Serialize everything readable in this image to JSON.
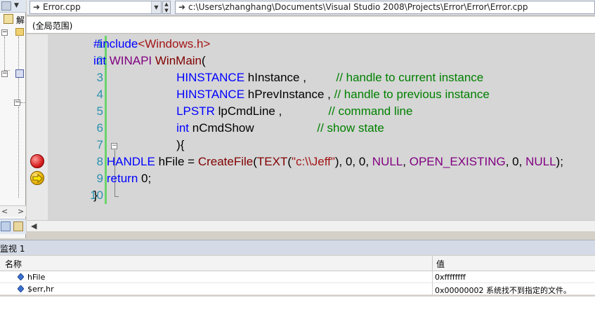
{
  "nav": {
    "file_combo": "Error.cpp",
    "path_combo": "c:\\Users\\zhanghang\\Documents\\Visual Studio 2008\\Projects\\Error\\Error\\Error.cpp",
    "scope": "(全局范围)"
  },
  "left_panel": {
    "partial_label": "解",
    "scroll_left": "<",
    "scroll_right": ">"
  },
  "code": {
    "line_numbers": [
      "1",
      "2",
      "3",
      "4",
      "5",
      "6",
      "7",
      "8",
      "9",
      "10"
    ],
    "lines": [
      {
        "segments": [
          {
            "t": "#include",
            "c": "kw"
          },
          {
            "t": "<Windows.h>",
            "c": "str"
          }
        ]
      },
      {
        "segments": [
          {
            "t": "int",
            "c": "kw"
          },
          {
            "t": " ",
            "c": ""
          },
          {
            "t": "WINAPI",
            "c": "mac"
          },
          {
            "t": " ",
            "c": ""
          },
          {
            "t": "WinMain",
            "c": "fn"
          },
          {
            "t": "(",
            "c": ""
          }
        ]
      },
      {
        "segments": [
          {
            "t": "                         HINSTANCE",
            "c": "kw"
          },
          {
            "t": " hInstance ,         ",
            "c": ""
          },
          {
            "t": "// handle to current instance",
            "c": "cm"
          }
        ]
      },
      {
        "segments": [
          {
            "t": "                         HINSTANCE",
            "c": "kw"
          },
          {
            "t": " hPrevInstance , ",
            "c": ""
          },
          {
            "t": "// handle to previous instance",
            "c": "cm"
          }
        ]
      },
      {
        "segments": [
          {
            "t": "                         LPSTR",
            "c": "kw"
          },
          {
            "t": " lpCmdLine ,              ",
            "c": ""
          },
          {
            "t": "// command line",
            "c": "cm"
          }
        ]
      },
      {
        "segments": [
          {
            "t": "                         int",
            "c": "kw"
          },
          {
            "t": " nCmdShow                   ",
            "c": ""
          },
          {
            "t": "// show state",
            "c": "cm"
          }
        ]
      },
      {
        "segments": [
          {
            "t": "                         ){",
            "c": ""
          }
        ]
      },
      {
        "segments": [
          {
            "t": "    HANDLE",
            "c": "kw"
          },
          {
            "t": " hFile = ",
            "c": ""
          },
          {
            "t": "CreateFile",
            "c": "fn"
          },
          {
            "t": "(",
            "c": ""
          },
          {
            "t": "TEXT",
            "c": "fn"
          },
          {
            "t": "(",
            "c": ""
          },
          {
            "t": "\"c:\\\\Jeff\"",
            "c": "str"
          },
          {
            "t": "), 0, 0, ",
            "c": ""
          },
          {
            "t": "NULL",
            "c": "mac"
          },
          {
            "t": ", ",
            "c": ""
          },
          {
            "t": "OPEN_EXISTING",
            "c": "mac"
          },
          {
            "t": ", 0, ",
            "c": ""
          },
          {
            "t": "NULL",
            "c": "mac"
          },
          {
            "t": ");",
            "c": ""
          }
        ]
      },
      {
        "segments": [
          {
            "t": "    return",
            "c": "kw"
          },
          {
            "t": " 0;",
            "c": ""
          }
        ]
      },
      {
        "segments": [
          {
            "t": "}",
            "c": ""
          }
        ]
      }
    ],
    "breakpoint_line": "8",
    "current_line": "9"
  },
  "watch": {
    "title": "监视 1",
    "col_name": "名称",
    "col_value": "值",
    "rows": [
      {
        "name": "hFile",
        "value": "0xffffffff"
      },
      {
        "name": "$err,hr",
        "value": "0x00000002 系统找不到指定的文件。"
      }
    ]
  },
  "colors": {
    "editor_bg": "#d6d6d6",
    "keyword": "#0000ff",
    "macro": "#800080",
    "string": "#a31515",
    "comment": "#008000",
    "line_number": "#2b91af"
  }
}
